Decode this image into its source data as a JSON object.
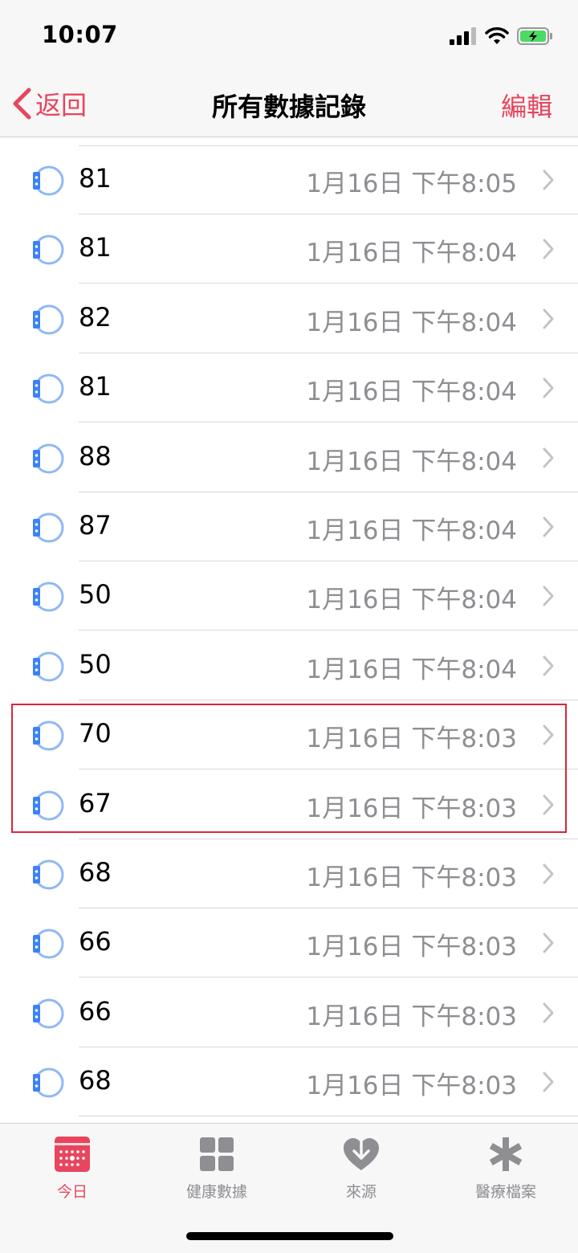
{
  "status_bar": {
    "time": "10:07"
  },
  "nav": {
    "back_label": "返回",
    "title": "所有數據記錄",
    "edit_label": "編輯"
  },
  "records": [
    {
      "value": "81",
      "date": "1月16日 下午8:05"
    },
    {
      "value": "81",
      "date": "1月16日 下午8:04"
    },
    {
      "value": "82",
      "date": "1月16日 下午8:04"
    },
    {
      "value": "81",
      "date": "1月16日 下午8:04"
    },
    {
      "value": "88",
      "date": "1月16日 下午8:04"
    },
    {
      "value": "87",
      "date": "1月16日 下午8:04"
    },
    {
      "value": "50",
      "date": "1月16日 下午8:04"
    },
    {
      "value": "50",
      "date": "1月16日 下午8:04"
    },
    {
      "value": "70",
      "date": "1月16日 下午8:03"
    },
    {
      "value": "67",
      "date": "1月16日 下午8:03"
    },
    {
      "value": "68",
      "date": "1月16日 下午8:03"
    },
    {
      "value": "66",
      "date": "1月16日 下午8:03"
    },
    {
      "value": "66",
      "date": "1月16日 下午8:03"
    },
    {
      "value": "68",
      "date": "1月16日 下午8:03"
    }
  ],
  "tabs": [
    {
      "label": "今日",
      "icon": "calendar-icon",
      "active": true
    },
    {
      "label": "健康數據",
      "icon": "grid-icon",
      "active": false
    },
    {
      "label": "來源",
      "icon": "heart-download-icon",
      "active": false
    },
    {
      "label": "醫療檔案",
      "icon": "asterisk-icon",
      "active": false
    }
  ],
  "colors": {
    "accent": "#e8455e",
    "secondary_text": "#8e8e93",
    "watch_icon": "#3b82f6",
    "highlight_box": "#d9263a"
  }
}
